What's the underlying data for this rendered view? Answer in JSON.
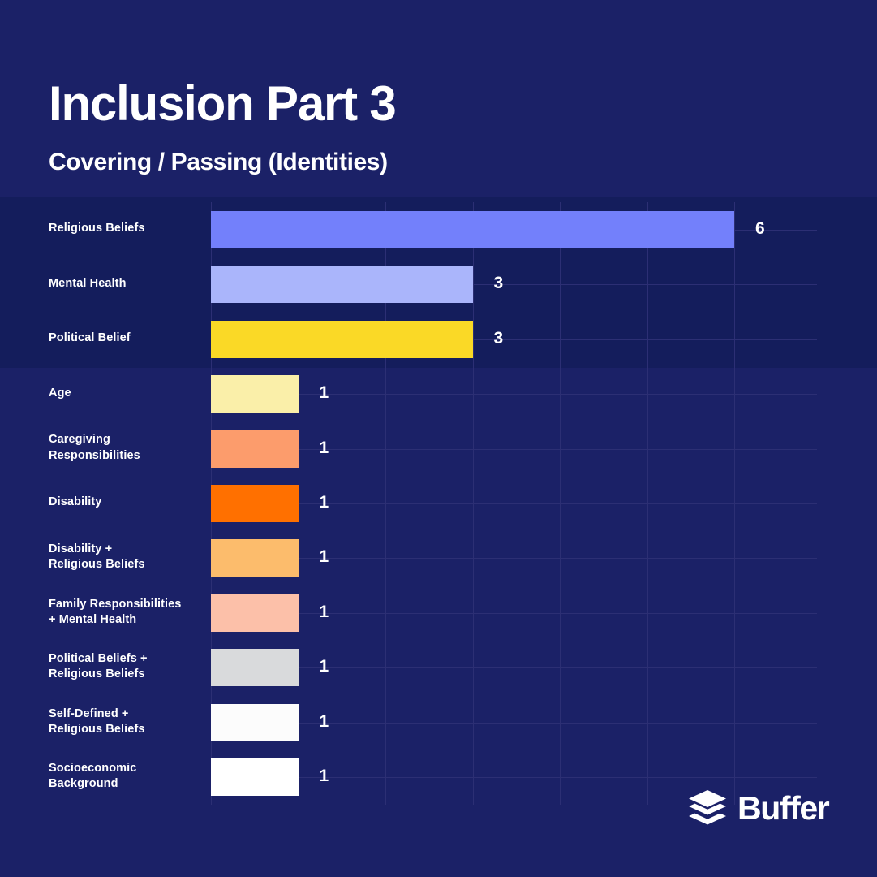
{
  "header": {
    "title": "Inclusion Part 3",
    "subtitle": "Covering / Passing (Identities)"
  },
  "branding": {
    "logo_icon": "buffer-layers-icon",
    "wordmark": "Buffer"
  },
  "theme": {
    "background": "#1b2167",
    "band": "#141d5c",
    "gridline": "#2c2f74",
    "text": "#ffffff"
  },
  "chart_data": {
    "type": "bar",
    "orientation": "horizontal",
    "title": "Inclusion Part 3",
    "subtitle": "Covering / Passing (Identities)",
    "xlabel": "",
    "ylabel": "",
    "xlim": [
      0,
      6
    ],
    "grid": true,
    "legend": false,
    "value_labels": true,
    "categories": [
      "Religious Beliefs",
      "Mental Health",
      "Political Belief",
      "Age",
      "Caregiving Responsibilities",
      "Disability",
      "Disability + Religious Beliefs",
      "Family Responsibilities + Mental Health",
      "Political Beliefs + Religious Beliefs",
      "Self-Defined + Religious Beliefs",
      "Socioeconomic Background"
    ],
    "values": [
      6,
      3,
      3,
      1,
      1,
      1,
      1,
      1,
      1,
      1,
      1
    ],
    "colors": [
      "#7380fb",
      "#aab5fb",
      "#fad926",
      "#faefa9",
      "#fc9c6c",
      "#ff7000",
      "#fcbc6c",
      "#fcc0a9",
      "#d9dadc",
      "#fcfcfc",
      "#ffffff"
    ],
    "bars": [
      {
        "label": "Religious Beliefs",
        "label_lines": [
          "Religious Beliefs"
        ],
        "value": 6,
        "value_text": "6",
        "color": "#7380fb"
      },
      {
        "label": "Mental Health",
        "label_lines": [
          "Mental Health"
        ],
        "value": 3,
        "value_text": "3",
        "color": "#aab5fb"
      },
      {
        "label": "Political Belief",
        "label_lines": [
          "Political Belief"
        ],
        "value": 3,
        "value_text": "3",
        "color": "#fad926"
      },
      {
        "label": "Age",
        "label_lines": [
          "Age"
        ],
        "value": 1,
        "value_text": "1",
        "color": "#faefa9"
      },
      {
        "label": "Caregiving Responsibilities",
        "label_lines": [
          "Caregiving",
          "Responsibilities"
        ],
        "value": 1,
        "value_text": "1",
        "color": "#fc9c6c"
      },
      {
        "label": "Disability",
        "label_lines": [
          "Disability"
        ],
        "value": 1,
        "value_text": "1",
        "color": "#ff7000"
      },
      {
        "label": "Disability + Religious Beliefs",
        "label_lines": [
          "Disability +",
          "Religious Beliefs"
        ],
        "value": 1,
        "value_text": "1",
        "color": "#fcbc6c"
      },
      {
        "label": "Family Responsibilities + Mental Health",
        "label_lines": [
          "Family Responsibilities",
          "+ Mental Health"
        ],
        "value": 1,
        "value_text": "1",
        "color": "#fcc0a9"
      },
      {
        "label": "Political Beliefs + Religious Beliefs",
        "label_lines": [
          "Political Beliefs +",
          "Religious Beliefs"
        ],
        "value": 1,
        "value_text": "1",
        "color": "#d9dadc"
      },
      {
        "label": "Self-Defined + Religious Beliefs",
        "label_lines": [
          "Self-Defined +",
          "Religious Beliefs"
        ],
        "value": 1,
        "value_text": "1",
        "color": "#fcfcfc"
      },
      {
        "label": "Socioeconomic Background",
        "label_lines": [
          "Socioeconomic",
          "Background"
        ],
        "value": 1,
        "value_text": "1",
        "color": "#ffffff"
      }
    ]
  }
}
